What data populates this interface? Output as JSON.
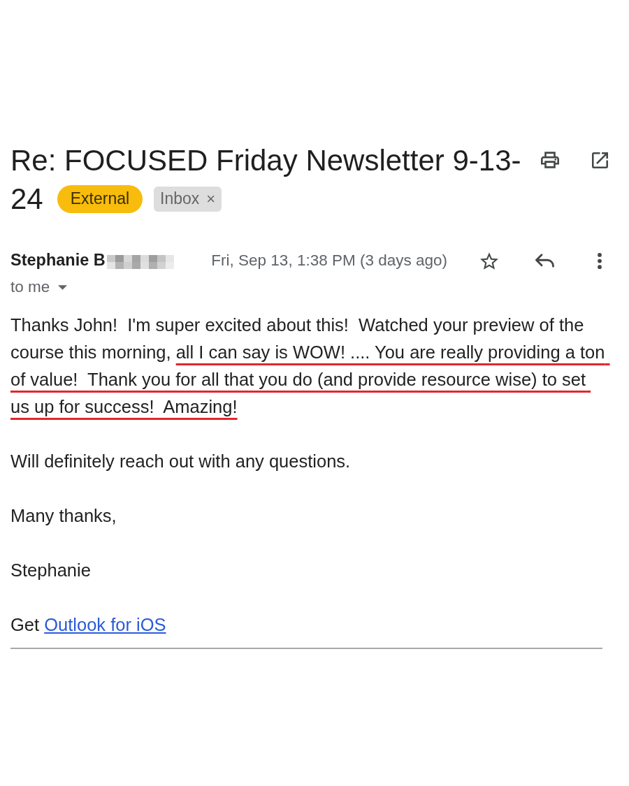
{
  "subject": {
    "text_lines": [
      "Re: FOCUSED Friday Newsletter 9-13-",
      "24"
    ],
    "labels": [
      {
        "kind": "external",
        "text": "External"
      },
      {
        "kind": "folder",
        "text": "Inbox",
        "remove": "×"
      }
    ]
  },
  "sender": {
    "name": "Stephanie B",
    "redacted": true,
    "date": "Fri, Sep 13, 1:38 PM (3 days ago)",
    "starred": false,
    "recipients": "to me"
  },
  "body": {
    "paragraphs": [
      {
        "parts": [
          {
            "text": "Thanks John!  I'm super excited about this!  Watched your preview of the course this morning, ",
            "underlined": false
          },
          {
            "text": "all I can say is WOW! .... You are really providing a ton of value!  Thank you for all that you do (and provide resource wise) to set us up for success!  Amazing!",
            "underlined": true
          }
        ]
      },
      {
        "parts": [
          {
            "text": "Will definitely reach out with any questions.",
            "underlined": false
          }
        ]
      },
      {
        "parts": [
          {
            "text": "Many thanks,",
            "underlined": false
          }
        ]
      },
      {
        "parts": [
          {
            "text": "Stephanie",
            "underlined": false
          }
        ]
      }
    ],
    "footer": {
      "prefix": "Get",
      "link": "Outlook for iOS"
    }
  }
}
